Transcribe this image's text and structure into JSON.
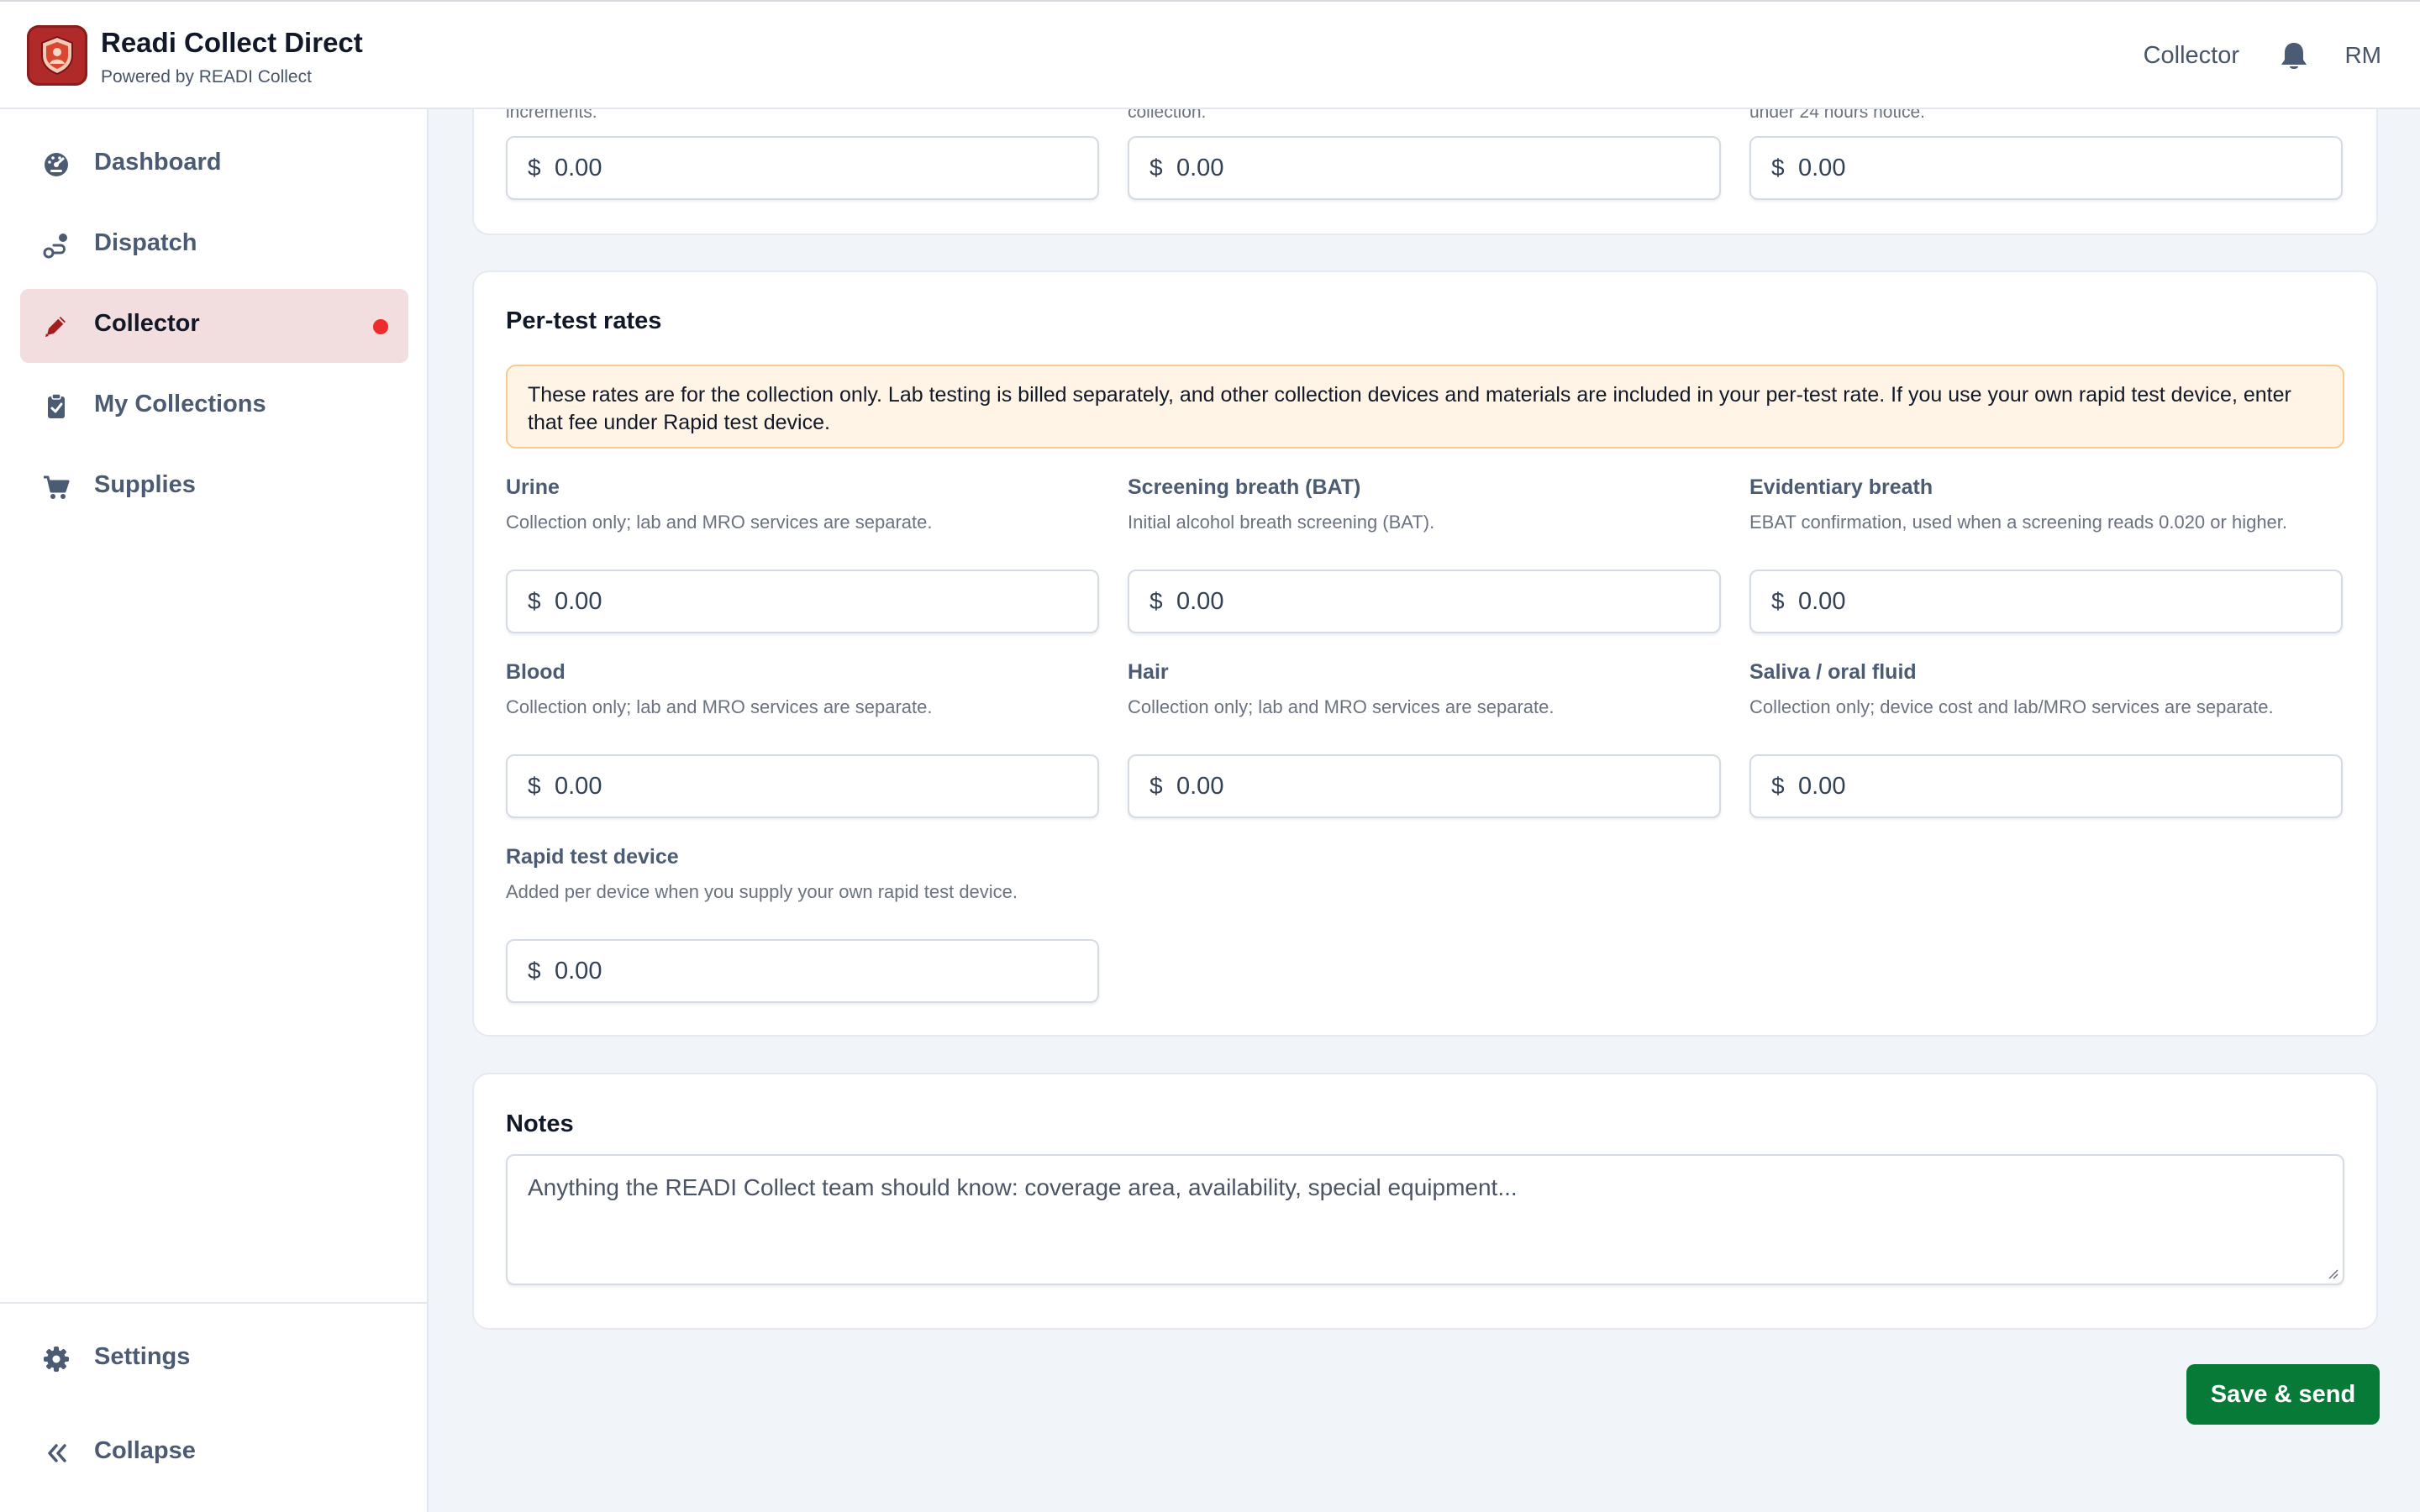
{
  "app": {
    "title": "Readi Collect Direct",
    "subtitle": "Powered by READI Collect",
    "role": "Collector",
    "user_initials": "RM",
    "brand_color": "#b12a2a"
  },
  "sidebar": {
    "items": [
      {
        "label": "Dashboard",
        "icon": "gauge-icon",
        "active": false
      },
      {
        "label": "Dispatch",
        "icon": "route-icon",
        "active": false
      },
      {
        "label": "Collector",
        "icon": "pen-icon",
        "active": true,
        "badge": "red-dot"
      },
      {
        "label": "My Collections",
        "icon": "clipboard-icon",
        "active": false
      },
      {
        "label": "Supplies",
        "icon": "cart-icon",
        "active": false
      }
    ],
    "footer": [
      {
        "label": "Settings",
        "icon": "gear-icon"
      },
      {
        "label": "Collapse",
        "icon": "chevrons-left-icon"
      }
    ]
  },
  "top_section": {
    "hints": [
      "increments.",
      "collection.",
      "under 24 hours notice."
    ],
    "fields": [
      {
        "currency": "$",
        "value": "0.00"
      },
      {
        "currency": "$",
        "value": "0.00"
      },
      {
        "currency": "$",
        "value": "0.00"
      }
    ]
  },
  "per_test": {
    "title": "Per-test rates",
    "notice": "These rates are for the collection only. Lab testing is billed separately, and other collection devices and materials are included in your per-test rate. If you use your own rapid test device, enter that fee under Rapid test device.",
    "fields": [
      {
        "label": "Urine",
        "help": "Collection only; lab and MRO services are separate.",
        "currency": "$",
        "value": "0.00"
      },
      {
        "label": "Screening breath (BAT)",
        "help": "Initial alcohol breath screening (BAT).",
        "currency": "$",
        "value": "0.00"
      },
      {
        "label": "Evidentiary breath",
        "help": "EBAT confirmation, used when a screening reads 0.020 or higher.",
        "currency": "$",
        "value": "0.00"
      },
      {
        "label": "Blood",
        "help": "Collection only; lab and MRO services are separate.",
        "currency": "$",
        "value": "0.00"
      },
      {
        "label": "Hair",
        "help": "Collection only; lab and MRO services are separate.",
        "currency": "$",
        "value": "0.00"
      },
      {
        "label": "Saliva / oral fluid",
        "help": "Collection only; device cost and lab/MRO services are separate.",
        "currency": "$",
        "value": "0.00"
      },
      {
        "label": "Rapid test device",
        "help": "Added per device when you supply your own rapid test device.",
        "currency": "$",
        "value": "0.00"
      }
    ]
  },
  "notes": {
    "title": "Notes",
    "placeholder": "Anything the READI Collect team should know: coverage area, availability, special equipment..."
  },
  "actions": {
    "save_label": "Save & send",
    "save_color": "#067a36"
  }
}
